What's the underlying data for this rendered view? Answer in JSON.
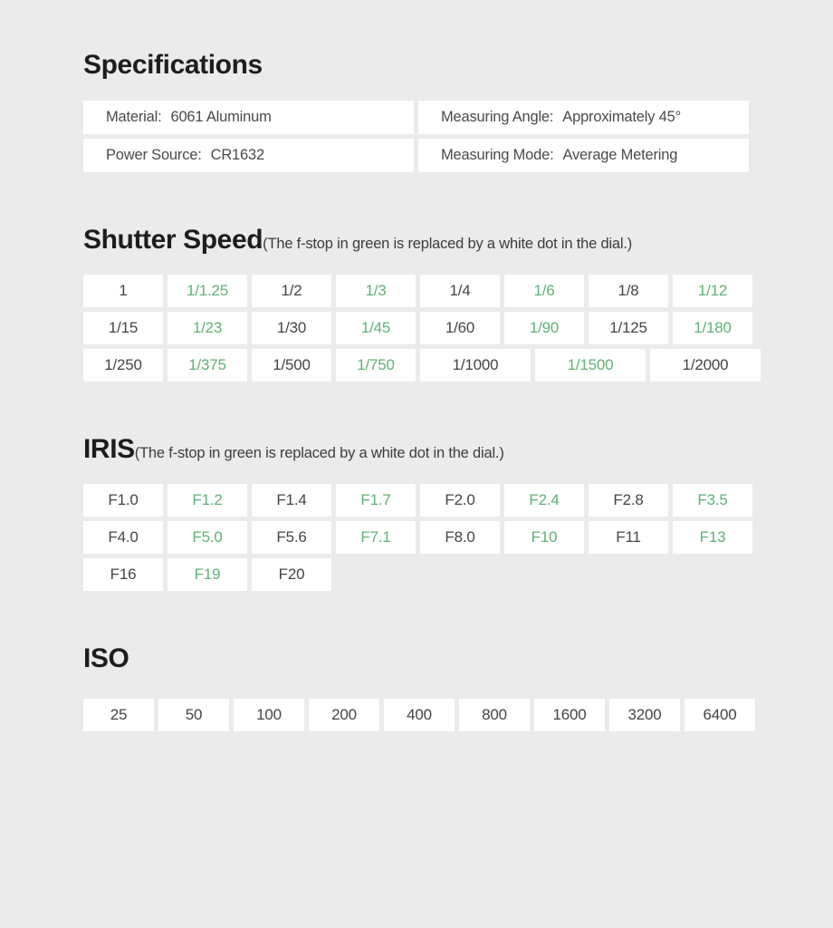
{
  "specifications": {
    "title": "Specifications",
    "rows_left": [
      {
        "label": "Material:",
        "value": "6061 Aluminum"
      },
      {
        "label": "Power Source:",
        "value": "CR1632"
      }
    ],
    "rows_right": [
      {
        "label": "Measuring Angle:",
        "value": "Approximately 45°"
      },
      {
        "label": "Measuring Mode:",
        "value": "Average Metering"
      }
    ]
  },
  "shutter": {
    "title": "Shutter Speed",
    "subtitle": "(The f-stop in green is replaced by a white dot in the dial.)",
    "rows": [
      [
        {
          "text": "1",
          "green": false
        },
        {
          "text": "1/1.25",
          "green": true
        },
        {
          "text": "1/2",
          "green": false
        },
        {
          "text": "1/3",
          "green": true
        },
        {
          "text": "1/4",
          "green": false
        },
        {
          "text": "1/6",
          "green": true
        },
        {
          "text": "1/8",
          "green": false
        },
        {
          "text": "1/12",
          "green": true
        }
      ],
      [
        {
          "text": "1/15",
          "green": false
        },
        {
          "text": "1/23",
          "green": true
        },
        {
          "text": "1/30",
          "green": false
        },
        {
          "text": "1/45",
          "green": true
        },
        {
          "text": "1/60",
          "green": false
        },
        {
          "text": "1/90",
          "green": true
        },
        {
          "text": "1/125",
          "green": false
        },
        {
          "text": "1/180",
          "green": true
        }
      ],
      [
        {
          "text": "1/250",
          "green": false
        },
        {
          "text": "1/375",
          "green": true
        },
        {
          "text": "1/500",
          "green": false
        },
        {
          "text": "1/750",
          "green": true
        },
        {
          "text": "1/1000",
          "green": false,
          "wide": true
        },
        {
          "text": "1/1500",
          "green": true,
          "wide": true
        },
        {
          "text": "1/2000",
          "green": false,
          "wide": true
        }
      ]
    ]
  },
  "iris": {
    "title": "IRIS",
    "subtitle": "(The f-stop in green is replaced by a white dot in the dial.)",
    "rows": [
      [
        {
          "text": "F1.0",
          "green": false
        },
        {
          "text": "F1.2",
          "green": true
        },
        {
          "text": "F1.4",
          "green": false
        },
        {
          "text": "F1.7",
          "green": true
        },
        {
          "text": "F2.0",
          "green": false
        },
        {
          "text": "F2.4",
          "green": true
        },
        {
          "text": "F2.8",
          "green": false
        },
        {
          "text": "F3.5",
          "green": true
        }
      ],
      [
        {
          "text": "F4.0",
          "green": false
        },
        {
          "text": "F5.0",
          "green": true
        },
        {
          "text": "F5.6",
          "green": false
        },
        {
          "text": "F7.1",
          "green": true
        },
        {
          "text": "F8.0",
          "green": false
        },
        {
          "text": "F10",
          "green": true
        },
        {
          "text": "F11",
          "green": false
        },
        {
          "text": "F13",
          "green": true
        }
      ],
      [
        {
          "text": "F16",
          "green": false
        },
        {
          "text": "F19",
          "green": true
        },
        {
          "text": "F20",
          "green": false
        }
      ]
    ]
  },
  "iso": {
    "title": "ISO",
    "rows": [
      [
        {
          "text": "25",
          "green": false
        },
        {
          "text": "50",
          "green": false
        },
        {
          "text": "100",
          "green": false
        },
        {
          "text": "200",
          "green": false
        },
        {
          "text": "400",
          "green": false
        },
        {
          "text": "800",
          "green": false
        },
        {
          "text": "1600",
          "green": false
        },
        {
          "text": "3200",
          "green": false
        },
        {
          "text": "6400",
          "green": false
        }
      ]
    ]
  },
  "colors": {
    "background": "#ebebeb",
    "cell_background": "#ffffff",
    "text": "#444444",
    "heading": "#1d1d1d",
    "accent_green": "#5fb176"
  }
}
